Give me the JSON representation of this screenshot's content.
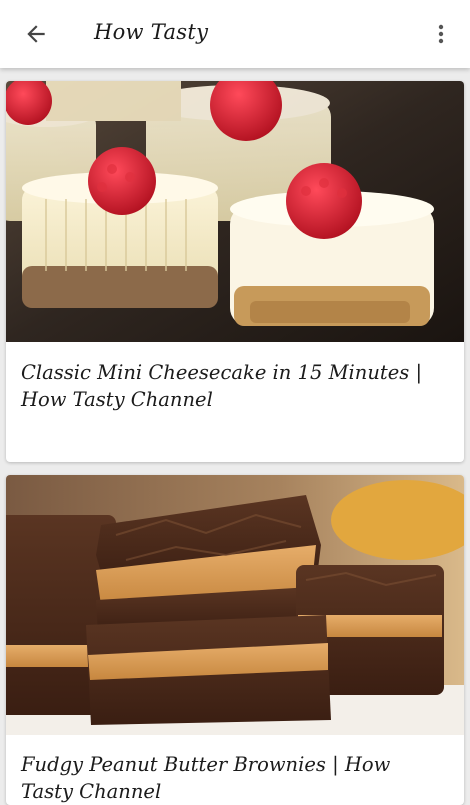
{
  "appbar": {
    "title": "How Tasty",
    "back_icon": "arrow-back-icon",
    "more_icon": "more-vert-icon"
  },
  "cards": [
    {
      "title": "Classic Mini Cheesecake in 15 Minutes | How Tasty Channel",
      "image": "mini cheesecakes with raspberries"
    },
    {
      "title": "Fudgy Peanut Butter Brownies | How Tasty Channel",
      "image": "peanut butter brownies"
    }
  ],
  "colors": {
    "appbar_bg": "#ffffff",
    "page_bg": "#ececec",
    "text": "#1b1b1b"
  }
}
